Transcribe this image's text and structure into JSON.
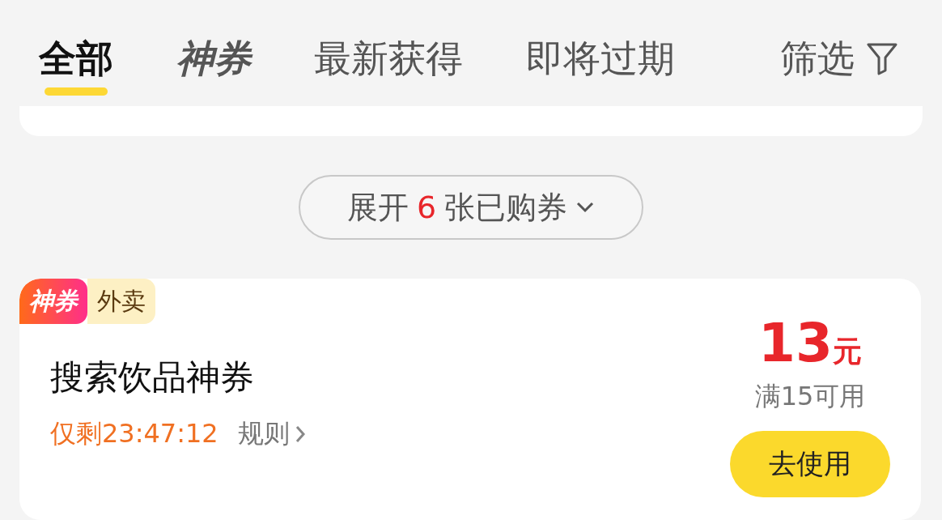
{
  "tabs": [
    {
      "label": "全部",
      "kind": "text",
      "selected": true
    },
    {
      "label": "神券",
      "kind": "logo",
      "selected": false
    },
    {
      "label": "最新获得",
      "kind": "text",
      "selected": false
    },
    {
      "label": "即将过期",
      "kind": "text",
      "selected": false
    }
  ],
  "filter": {
    "label": "筛选"
  },
  "expand_button": {
    "prefix": "展开",
    "count": "6",
    "suffix": "张已购券"
  },
  "coupon": {
    "badges": [
      {
        "label": "神券",
        "kind": "logo"
      },
      {
        "label": "外卖",
        "kind": "category"
      }
    ],
    "title": "搜索饮品神券",
    "countdown": "仅剩23:47:12",
    "rules_link": "规则",
    "amount": "13",
    "unit": "元",
    "condition": "满15可用",
    "use_button": "去使用"
  }
}
